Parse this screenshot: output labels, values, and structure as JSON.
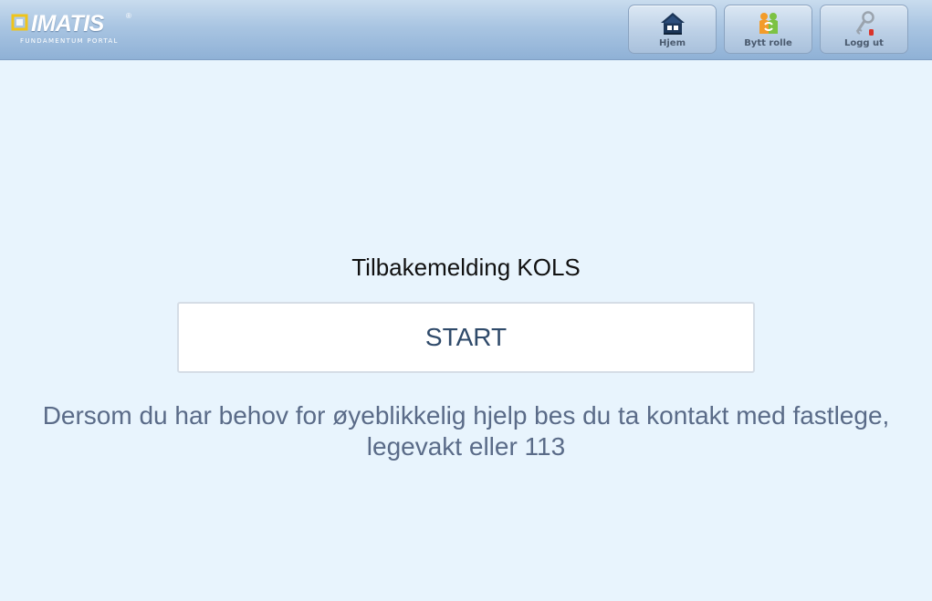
{
  "header": {
    "logo": {
      "name": "IMATIS",
      "registered_mark": "®",
      "subtitle": "FUNDAMENTUM PORTAL"
    },
    "buttons": [
      {
        "label": "Hjem",
        "icon": "home-icon"
      },
      {
        "label": "Bytt rolle",
        "icon": "switch-role-icon"
      },
      {
        "label": "Logg ut",
        "icon": "key-icon"
      }
    ]
  },
  "main": {
    "title": "Tilbakemelding KOLS",
    "start_label": "START",
    "notice_line1": "Dersom du har behov for øyeblikkelig hjelp bes du ta kontakt med fastlege,",
    "notice_line2": "legevakt eller 113"
  },
  "colors": {
    "background": "#e8f4fd",
    "header_gradient_top": "#c9dcee",
    "header_gradient_bottom": "#8fb1d6",
    "logo_accent": "#f0c419",
    "start_text": "#2f4a6a",
    "notice_text": "#5a6b88"
  }
}
